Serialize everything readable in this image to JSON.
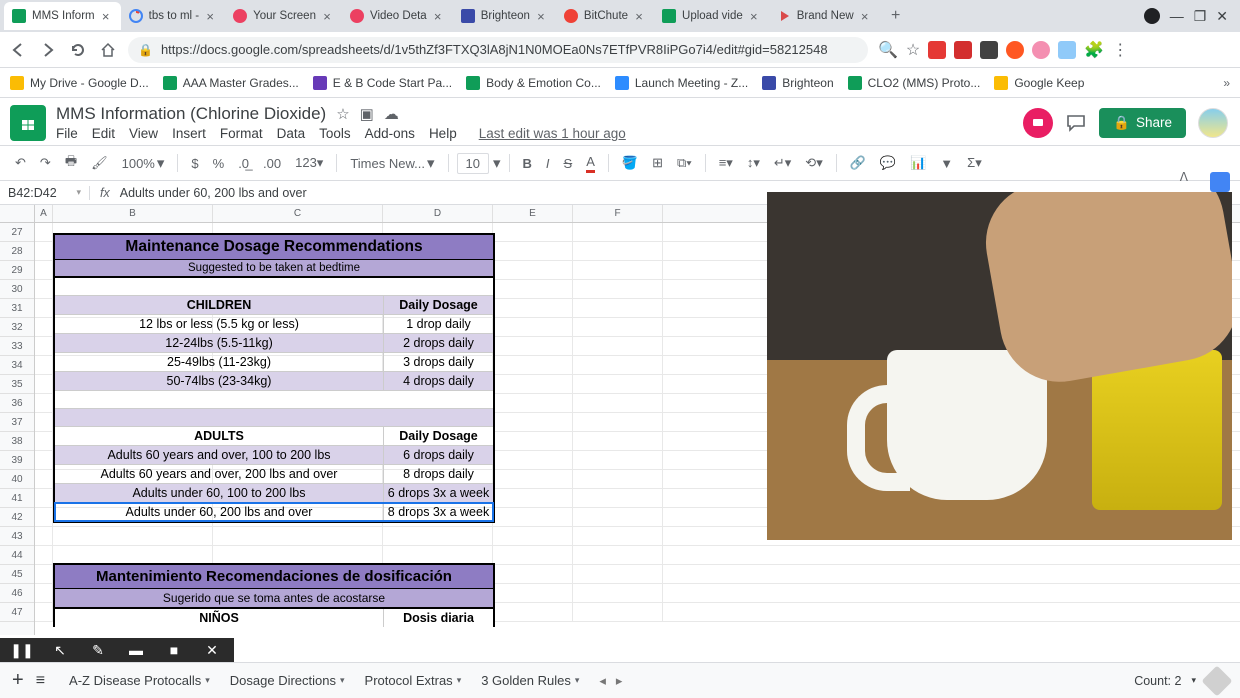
{
  "browser": {
    "tabs": [
      {
        "label": "MMS Inform",
        "active": true,
        "icon_color": "#0f9d58"
      },
      {
        "label": "tbs to ml -",
        "active": false,
        "icon_color": "#4285f4"
      },
      {
        "label": "Your Screen",
        "active": false,
        "icon_color": "#ec4061"
      },
      {
        "label": "Video Deta",
        "active": false,
        "icon_color": "#ec4061"
      },
      {
        "label": "Brighteon",
        "active": false,
        "icon_color": "#3a4aa8"
      },
      {
        "label": "BitChute",
        "active": false,
        "icon_color": "#ef4136"
      },
      {
        "label": "Upload vide",
        "active": false,
        "icon_color": "#0f9d58"
      },
      {
        "label": "Brand New",
        "active": false,
        "icon_color": "#d94a4a"
      }
    ],
    "url": "https://docs.google.com/spreadsheets/d/1v5thZf3FTXQ3lA8jN1N0MOEa0Ns7ETfPVR8IiPGo7i4/edit#gid=58212548",
    "bookmarks": [
      {
        "label": "My Drive - Google D...",
        "color": "#fbbc04"
      },
      {
        "label": "AAA Master Grades...",
        "color": "#0f9d58"
      },
      {
        "label": "E & B Code Start Pa...",
        "color": "#673ab7"
      },
      {
        "label": "Body & Emotion Co...",
        "color": "#0f9d58"
      },
      {
        "label": "Launch Meeting - Z...",
        "color": "#2d8cff"
      },
      {
        "label": "Brighteon",
        "color": "#3a4aa8"
      },
      {
        "label": "CLO2 (MMS) Proto...",
        "color": "#0f9d58"
      },
      {
        "label": "Google Keep",
        "color": "#fbbc04"
      }
    ]
  },
  "docs": {
    "title": "MMS Information (Chlorine Dioxide)",
    "menus": [
      "File",
      "Edit",
      "View",
      "Insert",
      "Format",
      "Data",
      "Tools",
      "Add-ons",
      "Help"
    ],
    "last_edit": "Last edit was 1 hour ago",
    "share": "Share"
  },
  "toolbar": {
    "zoom": "100%",
    "font": "Times New...",
    "font_size": "10"
  },
  "formula": {
    "name_box": "B42:D42",
    "text": "Adults under 60, 200 lbs and over"
  },
  "sheet": {
    "cols": [
      "A",
      "B",
      "C",
      "D",
      "E",
      "F"
    ],
    "row_start": 27,
    "row_end": 47,
    "table1": {
      "title": "Maintenance Dosage Recommendations",
      "subtitle": "Suggested to be taken at bedtime",
      "section1_header_l": "CHILDREN",
      "section1_header_r": "Daily Dosage",
      "section1_rows": [
        {
          "l": "12 lbs or less (5.5 kg or less)",
          "r": "1 drop daily"
        },
        {
          "l": "12-24lbs (5.5-11kg)",
          "r": "2 drops daily"
        },
        {
          "l": "25-49lbs (11-23kg)",
          "r": "3 drops daily"
        },
        {
          "l": "50-74lbs (23-34kg)",
          "r": "4 drops daily"
        }
      ],
      "section2_header_l": "ADULTS",
      "section2_header_r": "Daily Dosage",
      "section2_rows": [
        {
          "l": "Adults 60 years and over, 100 to 200 lbs",
          "r": "6 drops daily"
        },
        {
          "l": "Adults 60 years and over, 200 lbs and over",
          "r": "8 drops daily"
        },
        {
          "l": "Adults under 60, 100 to 200 lbs",
          "r": "6 drops 3x a week"
        },
        {
          "l": "Adults under 60, 200 lbs and over",
          "r": "8 drops 3x a week"
        }
      ]
    },
    "table2": {
      "title": "Mantenimiento Recomendaciones de dosificación",
      "subtitle": "Sugerido que se toma antes de acostarse",
      "header_l": "NIÑOS",
      "header_r": "Dosis diaria"
    }
  },
  "sheet_tabs": {
    "tabs": [
      "A-Z Disease Protocalls",
      "Dosage Directions",
      "Protocol Extras",
      "3 Golden Rules"
    ],
    "count_label": "Count: 2"
  }
}
